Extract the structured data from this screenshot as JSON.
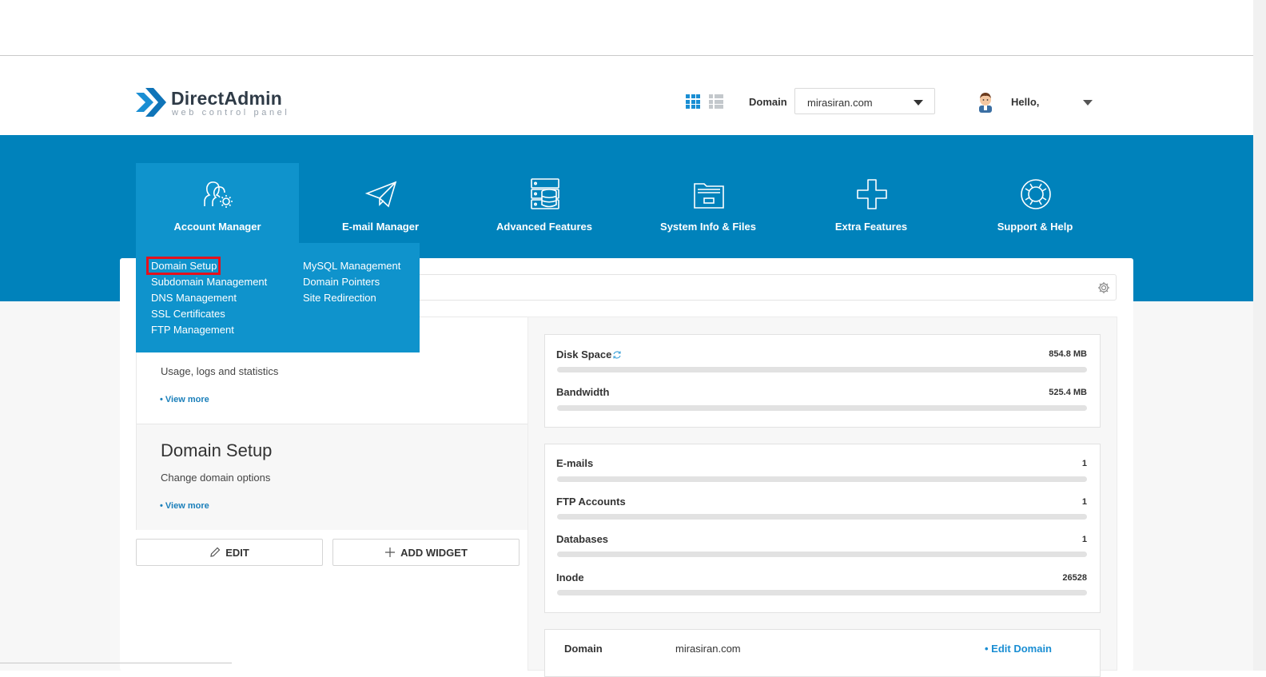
{
  "header": {
    "logo_title": "DirectAdmin",
    "logo_subtitle": "web control panel",
    "domain_label": "Domain",
    "domain_value": "mirasiran.com",
    "greeting": "Hello,"
  },
  "nav": {
    "items": [
      {
        "label": "Account Manager",
        "icon": "users-gear-icon",
        "active": true
      },
      {
        "label": "E-mail Manager",
        "icon": "paper-plane-icon"
      },
      {
        "label": "Advanced Features",
        "icon": "server-database-icon"
      },
      {
        "label": "System Info & Files",
        "icon": "folder-icon"
      },
      {
        "label": "Extra Features",
        "icon": "plus-icon"
      },
      {
        "label": "Support & Help",
        "icon": "lifebuoy-icon"
      }
    ]
  },
  "dropdown": {
    "col1": [
      "Domain Setup",
      "Subdomain Management",
      "DNS Management",
      "SSL Certificates",
      "FTP Management"
    ],
    "col2": [
      "MySQL Management",
      "Domain Pointers",
      "Site Redirection"
    ]
  },
  "widgets": {
    "stats": {
      "description": "Usage, logs and statistics",
      "more": "• View more"
    },
    "domain_setup": {
      "title": "Domain Setup",
      "description": "Change domain options",
      "more": "• View more"
    }
  },
  "buttons": {
    "edit": "EDIT",
    "add_widget": "ADD WIDGET"
  },
  "resources": {
    "disk_space": {
      "label": "Disk Space",
      "value": "854.8 MB"
    },
    "bandwidth": {
      "label": "Bandwidth",
      "value": "525.4 MB"
    },
    "emails": {
      "label": "E-mails",
      "value": "1"
    },
    "ftp": {
      "label": "FTP Accounts",
      "value": "1"
    },
    "databases": {
      "label": "Databases",
      "value": "1"
    },
    "inode": {
      "label": "Inode",
      "value": "26528"
    }
  },
  "domain_info": {
    "label": "Domain",
    "value": "mirasiran.com",
    "edit_link": "• Edit Domain"
  },
  "colors": {
    "brand_blue": "#0082bb",
    "active_nav": "#0f93cc",
    "highlight_red": "#e4111d",
    "link": "#1a7fba"
  }
}
